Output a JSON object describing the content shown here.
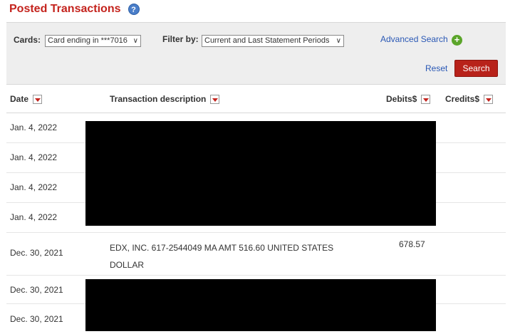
{
  "header": {
    "title": "Posted Transactions"
  },
  "filters": {
    "cards_label": "Cards:",
    "cards_value": "Card ending in ***7016",
    "filter_label": "Filter by:",
    "filter_value": "Current and Last Statement Periods",
    "advanced_search": "Advanced Search",
    "reset": "Reset",
    "search": "Search"
  },
  "table": {
    "columns": [
      "Date",
      "Transaction description",
      "Debits$",
      "Credits$"
    ],
    "rows": [
      {
        "date": "Jan. 4, 2022",
        "description": "",
        "debit": "",
        "credit": ""
      },
      {
        "date": "Jan. 4, 2022",
        "description": "",
        "debit": "",
        "credit": ""
      },
      {
        "date": "Jan. 4, 2022",
        "description": "",
        "debit": "",
        "credit": ""
      },
      {
        "date": "Jan. 4, 2022",
        "description": "",
        "debit": "",
        "credit": ""
      },
      {
        "date": "Dec. 30, 2021",
        "description": "EDX, INC. 617-2544049 MA AMT 516.60 UNITED STATES DOLLAR",
        "debit": "678.57",
        "credit": ""
      },
      {
        "date": "Dec. 30, 2021",
        "description": "",
        "debit": "",
        "credit": ""
      },
      {
        "date": "Dec. 30, 2021",
        "description": "",
        "debit": "",
        "credit": ""
      }
    ]
  }
}
